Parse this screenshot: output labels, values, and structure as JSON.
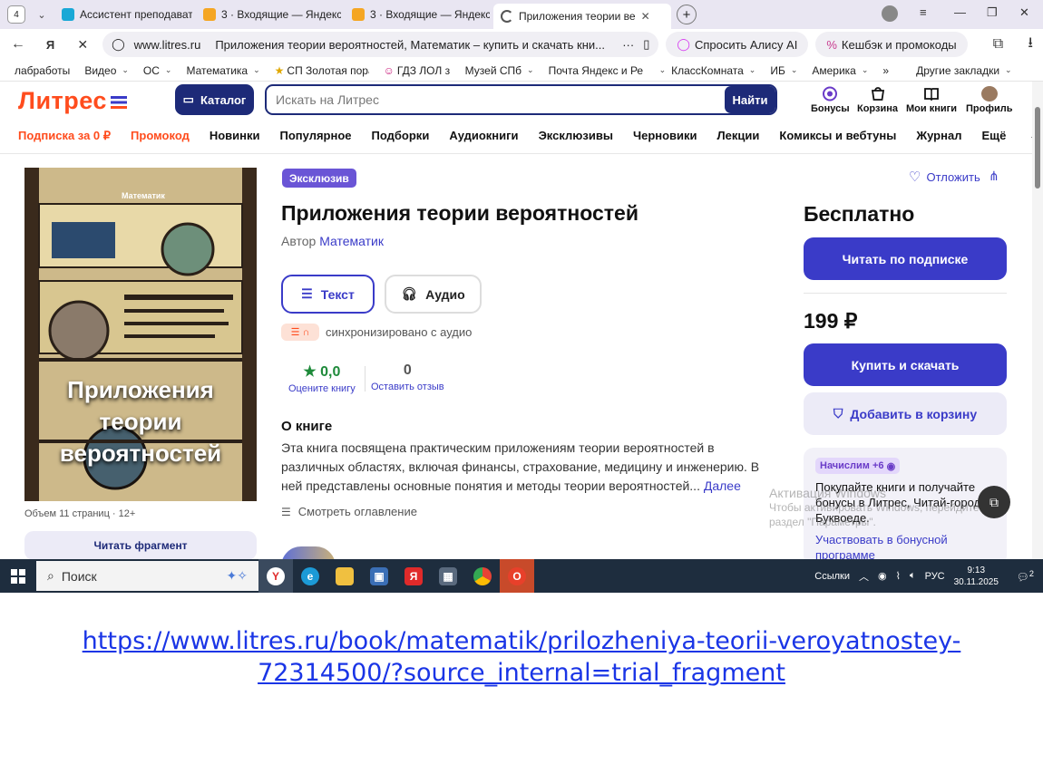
{
  "browser": {
    "tab_count": "4",
    "tabs": [
      {
        "title": "Ассистент преподавател",
        "icon_color": "#19a8d6"
      },
      {
        "title": "3 · Входящие — Яндекс П",
        "icon_color": "#f5a623"
      },
      {
        "title": "3 · Входящие — Яндекс П",
        "icon_color": "#f5a623"
      },
      {
        "title": "Приложения теории ве",
        "icon_color": "#555555"
      }
    ],
    "address": {
      "domain": "www.litres.ru",
      "page_title": "Приложения теории вероятностей, Математик – купить и скачать кни..."
    },
    "alice_label": "Спросить Алису AI",
    "cashback_label": "Кешбэк и промокоды",
    "bookmarks": [
      "лабработы",
      "Видео",
      "ОС",
      "Математика",
      "СП Золотая пора",
      "ГДЗ ЛОЛ з",
      "Музей СПб",
      "Почта Яндекс и Ре",
      "КлассКомната",
      "ИБ",
      "Америка"
    ],
    "more_bookmarks": "»",
    "other_bookmarks": "Другие закладки"
  },
  "site": {
    "logo": "Литрес",
    "catalog_label": "Каталог",
    "search_placeholder": "Искать на Литрес",
    "search_button": "Найти",
    "user_nav": [
      "Бонусы",
      "Корзина",
      "Мои книги",
      "Профиль"
    ],
    "menu": [
      "Подписка за 0 ₽",
      "Промокод",
      "Новинки",
      "Популярное",
      "Подборки",
      "Аудиокниги",
      "Эксклюзивы",
      "Черновики",
      "Лекции",
      "Комиксы и вебтуны",
      "Журнал",
      "Ещё"
    ]
  },
  "book": {
    "badge": "Эксклюзив",
    "title": "Приложения теории вероятностей",
    "author_prefix": "Автор",
    "author": "Математик",
    "cover_author": "Математик",
    "cover_title": "Приложения теории вероятностей",
    "format_text": "Текст",
    "format_audio": "Аудио",
    "sync_text": "синхронизировано с аудио",
    "rating_value": "0,0",
    "rating_label": "Оцените книгу",
    "reviews_value": "0",
    "reviews_label": "Оставить отзыв",
    "about_heading": "О книге",
    "description": "Эта книга посвящена практическим приложениям теории вероятностей в различных областях, включая финансы, страхование, медицину и инженерию. В ней представлены основные понятия и методы теории вероятностей...",
    "more_link": "Далее",
    "toc_label": "Смотреть оглавление",
    "volume": "Объем 11 страниц",
    "age": "12+",
    "fragment_button": "Читать фрагмент"
  },
  "purchase": {
    "save_label": "Отложить",
    "free_label": "Бесплатно",
    "subscribe_button": "Читать по подписке",
    "price": "199 ₽",
    "buy_button": "Купить и скачать",
    "cart_button": "Добавить в корзину",
    "bonus_badge": "Начислим +6",
    "bonus_text": "Покупайте книги и получайте бонусы в Литрес, Читай-город и Буквоеде.",
    "bonus_link": "Участвовать в бонусной программе"
  },
  "watermark": {
    "line1": "Активация Windows",
    "line2": "Чтобы активировать Windows, перейдите в",
    "line3": "раздел \"Параметры\"."
  },
  "taskbar": {
    "search_label": "Поиск",
    "links_label": "Ссылки",
    "lang": "РУС",
    "time": "9:13",
    "date": "30.11.2025",
    "notif_count": "2"
  },
  "bottom_link": {
    "line1": "https://www.litres.ru/book/matematik/prilozheniya-teorii-veroyatnostey-",
    "line2": "72314500/?source_internal=trial_fragment"
  },
  "colors": {
    "brand_orange": "#ff4c1d",
    "brand_blue": "#3a3bc8",
    "navy": "#1d2a78",
    "link_blue": "#1a35e6"
  }
}
